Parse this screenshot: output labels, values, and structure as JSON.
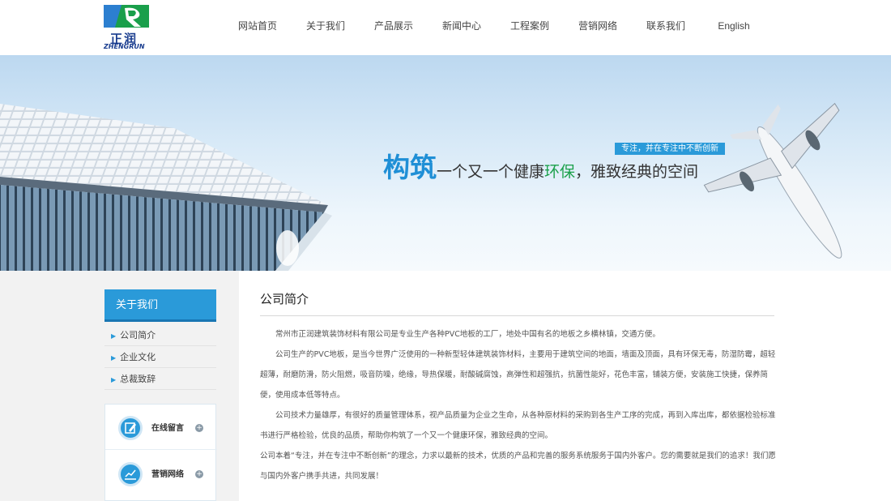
{
  "logo": {
    "cn": "正润",
    "en": "ZHENGRUN"
  },
  "nav": {
    "items": [
      "网站首页",
      "关于我们",
      "产品展示",
      "新闻中心",
      "工程案例",
      "营销网络",
      "联系我们",
      "English"
    ]
  },
  "banner": {
    "tag": "专注，并在专注中不断创新",
    "slogan_big": "构筑",
    "slogan_mid1": "一个又一个健康",
    "slogan_green": "环保",
    "slogan_mid2": "，雅致经典的空间"
  },
  "sidebar": {
    "title": "关于我们",
    "items": [
      {
        "label": "公司简介"
      },
      {
        "label": "企业文化"
      },
      {
        "label": "总裁致辞"
      }
    ],
    "boxes": [
      {
        "label": "在线留言",
        "icon": "edit-icon"
      },
      {
        "label": "营销网络",
        "icon": "chart-icon"
      }
    ]
  },
  "content": {
    "title": "公司简介",
    "paragraphs": [
      "常州市正润建筑装饰材料有限公司是专业生产各种PVC地板的工厂，地处中国有名的地板之乡横林镇，交通方便。",
      "公司生产的PVC地板，是当今世界广泛使用的一种新型轻体建筑装饰材料，主要用于建筑空间的地面，墙面及顶面，具有环保无毒，防湿防霉，超轻超薄，耐磨防滑，防火阻燃，吸音防噪，绝缘，导热保暖，耐酸碱腐蚀，高弹性和超强抗，抗菌性能好，花色丰富，铺装方便，安装施工快捷，保养简便，使用成本低等特点。",
      "公司技术力量雄厚，有很好的质量管理体系，视产品质量为企业之生命，从各种原材料的采购到各生产工序的完成，再到入库出库，都依据检验标准书进行严格检验，优良的品质，帮助你构筑了一个又一个健康环保，雅致经典的空间。",
      "公司本着“专注，并在专注中不断创新”的理念，力求以最新的技术，优质的产品和完善的服务系统服务于国内外客户。您的需要就是我们的追求！我们愿与国内外客户携手共进，共同发展！"
    ]
  },
  "colors": {
    "accent": "#2a9ad9",
    "green": "#1aa04a",
    "logo_blue": "#1a3d8f"
  }
}
